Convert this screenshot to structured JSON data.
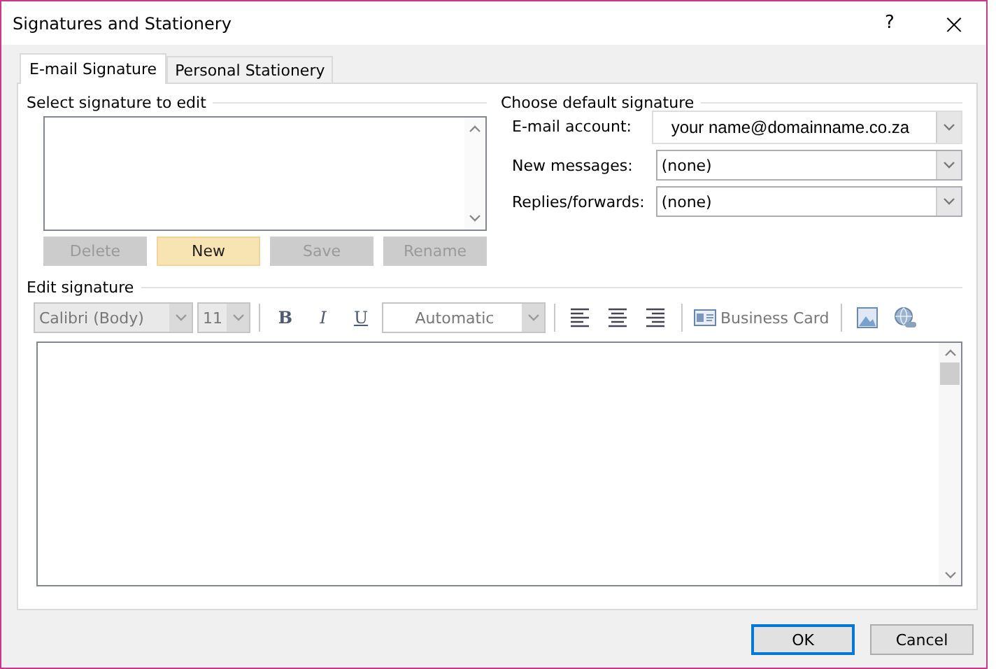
{
  "window": {
    "title": "Signatures and Stationery",
    "help": "?",
    "close": "×"
  },
  "tabs": [
    {
      "label": "E-mail Signature",
      "selected": true
    },
    {
      "label": "Personal Stationery",
      "selected": false
    }
  ],
  "select_signature": {
    "heading": "Select signature to edit",
    "buttons": [
      {
        "label": "Delete",
        "disabled": true,
        "highlighted": false
      },
      {
        "label": "New",
        "disabled": false,
        "highlighted": true
      },
      {
        "label": "Save",
        "disabled": true,
        "highlighted": false
      },
      {
        "label": "Rename",
        "disabled": true,
        "highlighted": false
      }
    ]
  },
  "default_signature": {
    "heading": "Choose default signature",
    "fields": [
      {
        "label": "E-mail account:",
        "value": "your name@domainname.co.za"
      },
      {
        "label": "New messages:",
        "value": "(none)"
      },
      {
        "label": "Replies/forwards:",
        "value": "(none)"
      }
    ]
  },
  "edit_signature": {
    "heading": "Edit signature",
    "toolbar": [
      {
        "kind": "combo",
        "text": "Calibri (Body)"
      },
      {
        "kind": "combo",
        "text": "11"
      },
      {
        "kind": "separator"
      },
      {
        "kind": "bold",
        "text": "B"
      },
      {
        "kind": "italic",
        "text": "I"
      },
      {
        "kind": "underline",
        "text": "U"
      },
      {
        "kind": "color",
        "text": "Automatic"
      },
      {
        "kind": "separator"
      },
      {
        "kind": "align-left"
      },
      {
        "kind": "align-center"
      },
      {
        "kind": "align-right"
      },
      {
        "kind": "separator"
      },
      {
        "kind": "card",
        "text": "Business Card"
      },
      {
        "kind": "separator"
      },
      {
        "kind": "image"
      },
      {
        "kind": "link"
      }
    ]
  },
  "buttons": [
    {
      "label": "OK",
      "default": true
    },
    {
      "label": "Cancel",
      "default": false
    }
  ]
}
